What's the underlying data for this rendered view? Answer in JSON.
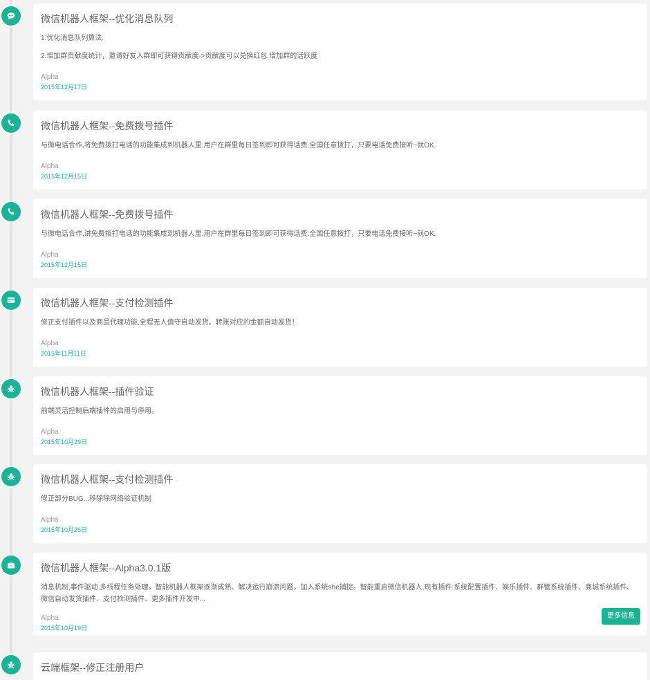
{
  "entries": [
    {
      "icon": "comment-icon",
      "title": "微信机器人框架--优化消息队列",
      "lines": [
        "1.优化消息队列算法.",
        "2.增加群贡献度统计，邀请好友入群即可获得贡献度->贡献度可以兑换红包.增加群的活跃度"
      ],
      "author": "Alpha",
      "date": "2015年12月17日"
    },
    {
      "icon": "phone-icon",
      "title": "微信机器人框架--免费拨号插件",
      "lines": [
        "与微电话合作,将免费拨打电话的功能集成到机器人里.用户在群里每日签到即可获得话费.全国任意拨打，只要电话免费接听~就OK."
      ],
      "author": "Alpha",
      "date": "2015年12月15日"
    },
    {
      "icon": "phone-icon",
      "title": "微信机器人框架--免费拨号插件",
      "lines": [
        "与微电话合作,讲免费拨打电话的功能集成到机器人里.用户在群里每日签到即可获得话费.全国任意拨打，只要电话免费接听~就OK."
      ],
      "author": "Alpha",
      "date": "2015年12月15日"
    },
    {
      "icon": "credit-card-icon",
      "title": "微信机器人框架--支付检测插件",
      "lines": [
        "修正支付插件以及商品代理功能,全程无人值守自动发货。转账对应的金额自动发货！"
      ],
      "author": "Alpha",
      "date": "2015年11月11日"
    },
    {
      "icon": "bug-icon",
      "title": "微信机器人框架--插件验证",
      "lines": [
        "前端灵活控制后端插件的启用与停用。"
      ],
      "author": "Alpha",
      "date": "2015年10月29日"
    },
    {
      "icon": "bug-icon",
      "title": "微信机器人框架--支付检测插件",
      "lines": [
        "修正部分BUG...移除除网络验证机制"
      ],
      "author": "Alpha",
      "date": "2015年10月26日"
    },
    {
      "icon": "briefcase-icon",
      "title": "微信机器人框架--Alpha3.0.1版",
      "lines": [
        "消息机制,事件驱动,多线程任务处理。智能机器人框架逐渐成熟、解决运行崩溃问题。加入系统she捕捉。智能重启微信机器人,现有插件:系统配置插件、娱乐插件、群管系统插件、商城系统插件、微信自动发货插件、支付检测插件、更多插件开发中..."
      ],
      "author": "Alpha",
      "date": "2015年10月19日",
      "button": "更多信息"
    },
    {
      "icon": "bug-icon",
      "title": "云端框架--修正注册用户",
      "lines": [],
      "author": "",
      "date": ""
    }
  ],
  "colors": {
    "accent": "#1ab394",
    "background": "#f3f3f3",
    "card": "#ffffff"
  }
}
